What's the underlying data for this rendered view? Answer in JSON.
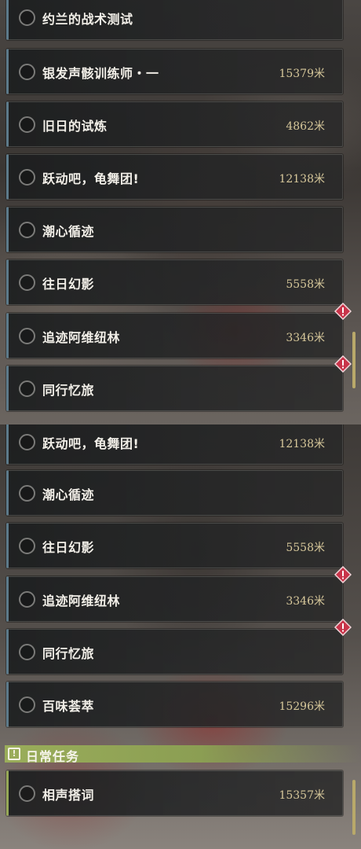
{
  "top_list": [
    {
      "name": "约兰的战术测试",
      "distance": "",
      "alert": false
    },
    {
      "name": "银发声骸训练师・一",
      "distance": "15379米",
      "alert": false
    },
    {
      "name": "旧日的试炼",
      "distance": "4862米",
      "alert": false
    },
    {
      "name": "跃动吧，龟舞团!",
      "distance": "12138米",
      "alert": false
    },
    {
      "name": "潮心循迹",
      "distance": "",
      "alert": false
    },
    {
      "name": "往日幻影",
      "distance": "5558米",
      "alert": false
    },
    {
      "name": "追迹阿维纽林",
      "distance": "3346米",
      "alert": true
    },
    {
      "name": "同行忆旅",
      "distance": "",
      "alert": true
    }
  ],
  "bottom_list": [
    {
      "name": "跃动吧，龟舞团!",
      "distance": "12138米",
      "alert": false
    },
    {
      "name": "潮心循迹",
      "distance": "",
      "alert": false
    },
    {
      "name": "往日幻影",
      "distance": "5558米",
      "alert": false
    },
    {
      "name": "追迹阿维纽林",
      "distance": "3346米",
      "alert": true
    },
    {
      "name": "同行忆旅",
      "distance": "",
      "alert": true
    },
    {
      "name": "百味荟萃",
      "distance": "15296米",
      "alert": false
    }
  ],
  "daily_section": {
    "title": "日常任务",
    "icon": "exclamation-box-icon",
    "items": [
      {
        "name": "相声搭词",
        "distance": "15357米",
        "alert": false
      }
    ]
  },
  "colors": {
    "alert": "#c8344a",
    "scrollbar": "#b9a96a",
    "daily_header": "#9aad5a",
    "distance_text": "#d6c79a"
  }
}
